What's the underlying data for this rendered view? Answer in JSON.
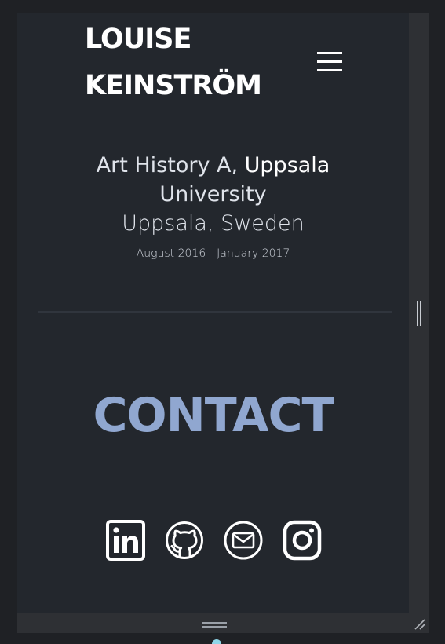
{
  "header": {
    "name_line1": "LOUISE",
    "name_line2": "KEINSTRÖM",
    "menu_icon": "hamburger-menu-icon"
  },
  "education": {
    "title_part1": "Art History A, ",
    "title_part2": "Uppsala",
    "title_line2": "University",
    "place": "Uppsala, Sweden",
    "dates": "August 2016 - January 2017"
  },
  "contact": {
    "heading": "CONTACT",
    "accent_color": "#90a7d0",
    "links": [
      {
        "icon": "linkedin-icon"
      },
      {
        "icon": "github-icon"
      },
      {
        "icon": "email-icon"
      },
      {
        "icon": "instagram-icon"
      }
    ]
  }
}
